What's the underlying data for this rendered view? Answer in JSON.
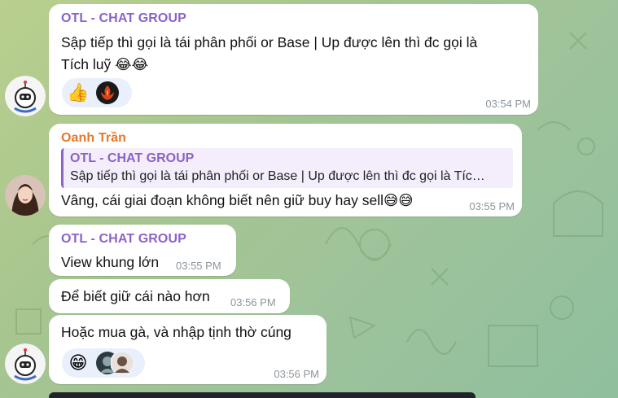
{
  "colors": {
    "accent_purple": "#8b63c9",
    "sender_orange": "#e5782b",
    "time_gray": "#8c959c",
    "reaction_bg": "#e9f0fb"
  },
  "messages": [
    {
      "sender": "OTL - CHAT GROUP",
      "line1": "Sập tiếp thì gọi là tái phân phối or Base | Up được lên thì đc gọi là",
      "line2": "Tích luỹ 😂😂",
      "time": "03:54 PM",
      "reactions": [
        "thumbs-up",
        "phoenix-avatar"
      ]
    },
    {
      "sender": "Oanh Trần",
      "quote_title": "OTL - CHAT GROUP",
      "quote_text": "Sập tiếp thì gọi là tái phân phối or Base | Up được lên thì đc gọi là Tíc…",
      "text": "Vâng, cái giai đoạn không biết nên giữ buy hay sell😅😅",
      "time": "03:55 PM"
    },
    {
      "sender": "OTL - CHAT GROUP",
      "text": "View khung lớn",
      "time": "03:55 PM"
    },
    {
      "text": "Để biết giữ cái nào hơn",
      "time": "03:56 PM"
    },
    {
      "text": "Hoặc mua gà, và nhập tịnh thờ cúng",
      "time": "03:56 PM",
      "reactions": [
        "grinning-emoji",
        "user-avatars"
      ]
    }
  ]
}
